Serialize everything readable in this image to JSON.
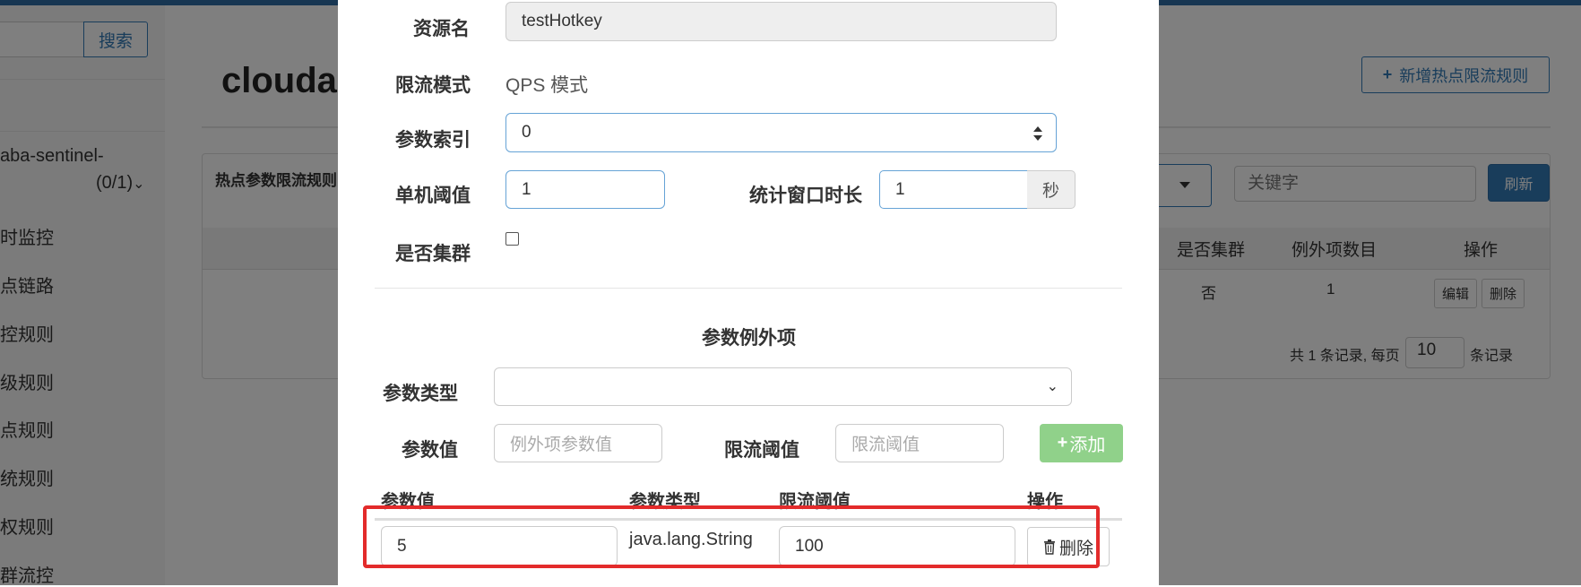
{
  "background": {
    "sidebar": {
      "search_button": "搜索",
      "app_name": "aba-sentinel-",
      "app_count": "(0/1)",
      "items": [
        "时监控",
        "点链路",
        "控规则",
        "级规则",
        "点规则",
        "统规则",
        "权规则",
        "群流控"
      ]
    },
    "main_title": "clouda",
    "add_rule_button": "新增热点限流规则",
    "panel_heading": "热点参数限流规则",
    "keyword_placeholder": "关键字",
    "refresh_button": "刷新",
    "table": {
      "headers": [
        "是否集群",
        "例外项数目",
        "操作"
      ],
      "row": {
        "cluster": "否",
        "exception_count": "1",
        "edit": "编辑",
        "delete": "删除"
      }
    },
    "pager": {
      "prefix": "共 1 条记录, 每页",
      "page_size": "10",
      "suffix": "条记录"
    }
  },
  "modal": {
    "resource_label": "资源名",
    "resource_value": "testHotkey",
    "mode_label": "限流模式",
    "mode_value": "QPS 模式",
    "param_index_label": "参数索引",
    "param_index_value": "0",
    "threshold_label": "单机阈值",
    "threshold_value": "1",
    "window_label": "统计窗口时长",
    "window_value": "1",
    "window_unit": "秒",
    "cluster_label": "是否集群",
    "exceptions_title": "参数例外项",
    "param_type_label": "参数类型",
    "param_type_value": "",
    "param_value_label": "参数值",
    "param_value_placeholder": "例外项参数值",
    "limit_label": "限流阈值",
    "limit_placeholder": "限流阈值",
    "add_button": "添加",
    "exceptions_table": {
      "headers": [
        "参数值",
        "参数类型",
        "限流阈值",
        "操作"
      ],
      "row": {
        "value": "5",
        "type": "java.lang.String",
        "limit": "100",
        "delete": "删除"
      }
    }
  },
  "colors": {
    "primary": "#337ab7",
    "success_light": "#90d18a",
    "highlight": "#e32b2b"
  }
}
